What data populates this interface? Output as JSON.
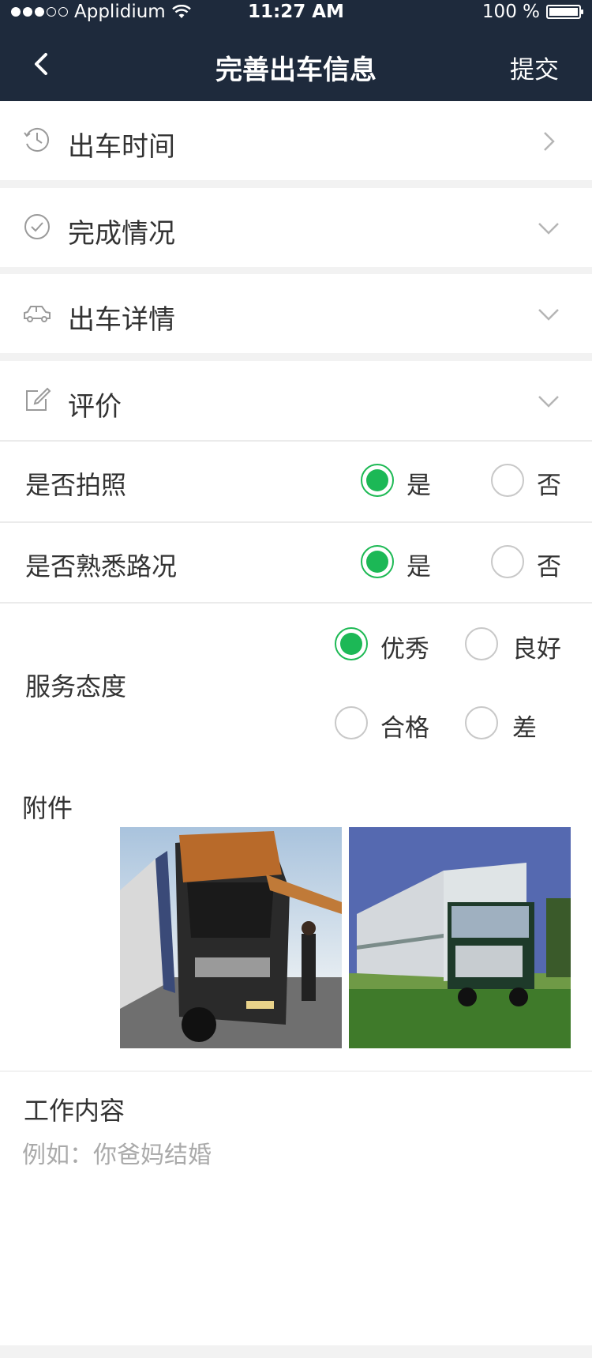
{
  "status_bar": {
    "carrier": "Applidium",
    "time": "11:27 AM",
    "battery": "100 %"
  },
  "nav": {
    "title": "完善出车信息",
    "submit_label": "提交"
  },
  "sections": [
    {
      "label": "出车时间",
      "icon": "clock-icon",
      "indicator": "chevron-right-icon"
    },
    {
      "label": "完成情况",
      "icon": "check-circle-icon",
      "indicator": "chevron-down-icon"
    },
    {
      "label": "出车详情",
      "icon": "car-icon",
      "indicator": "chevron-down-icon"
    },
    {
      "label": "评价",
      "icon": "edit-icon",
      "indicator": "chevron-down-icon"
    }
  ],
  "questions": {
    "photo": {
      "label": "是否拍照",
      "yes": "是",
      "no": "否",
      "selected": "是"
    },
    "road": {
      "label": "是否熟悉路况",
      "yes": "是",
      "no": "否",
      "selected": "是"
    },
    "service": {
      "label": "服务态度",
      "options": [
        "优秀",
        "良好",
        "合格",
        "差"
      ],
      "selected": "优秀"
    }
  },
  "attachments": {
    "title": "附件"
  },
  "work": {
    "title": "工作内容",
    "placeholder": "例如：你爸妈结婚"
  },
  "colors": {
    "nav_bg": "#1e2a3c",
    "accent_green": "#1cb856"
  }
}
